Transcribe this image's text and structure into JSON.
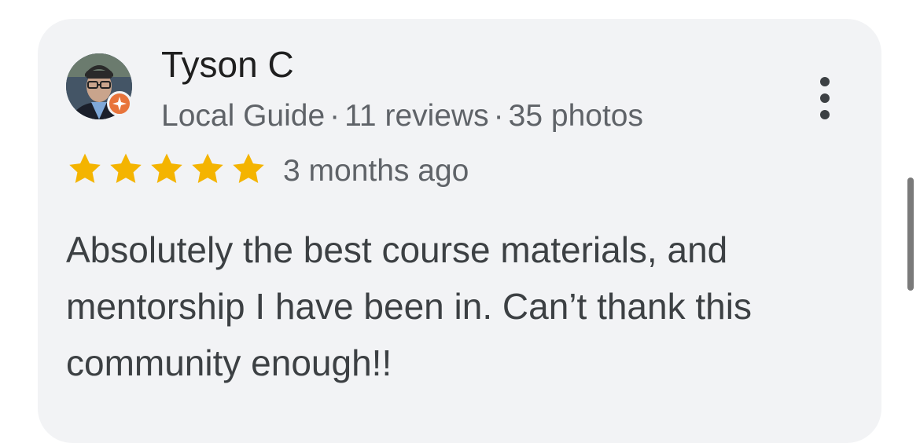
{
  "review": {
    "reviewer_name": "Tyson C",
    "reviewer_badge": "Local Guide",
    "reviews_count": "11 reviews",
    "photos_count": "35 photos",
    "meta_separator": "·",
    "rating": 5,
    "rating_max": 5,
    "date": "3 months ago",
    "text": "Absolutely the best course materials, and mentorship I have been in. Can’t thank this community enough!!"
  },
  "icons": {
    "avatar": "profile-photo",
    "badge": "local-guide-icon",
    "more": "more-vert-icon",
    "star": "star-icon"
  },
  "colors": {
    "card_background": "#f2f3f5",
    "star": "#f4b400",
    "badge": "#e8743b",
    "primary_text": "#1f1f1f",
    "secondary_text": "#5f6368"
  }
}
